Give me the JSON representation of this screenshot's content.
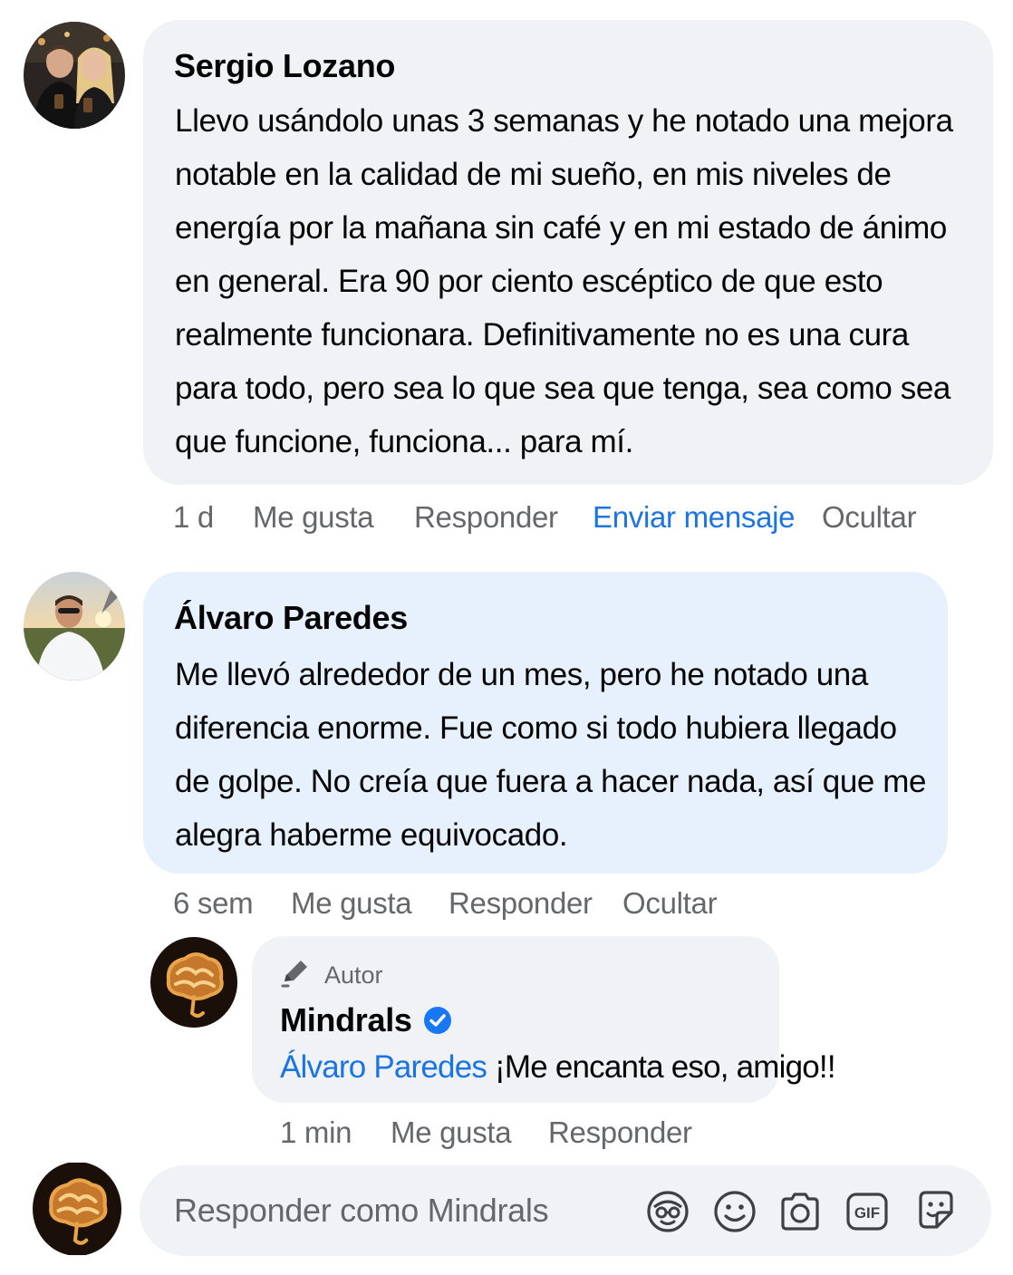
{
  "comments": [
    {
      "author": "Sergio Lozano",
      "text": "Llevo usándolo unas 3 semanas y he notado una mejora notable en la calidad de mi sueño, en mis niveles de energía por la mañana sin café y en mi estado de ánimo en general. Era 90 por ciento escéptico de que esto realmente funcionara. Definitivamente no es una cura para todo, pero sea lo que sea que tenga, sea como sea que funcione, funciona... para mí.",
      "time": "1 d",
      "like": "Me gusta",
      "reply": "Responder",
      "message": "Enviar mensaje",
      "hide": "Ocultar"
    },
    {
      "author": "Álvaro Paredes",
      "text": "Me llevó alrededor de un mes, pero he notado una diferencia enorme. Fue como si todo hubiera llegado de golpe. No creía que fuera a hacer nada, así que me alegra haberme equivocado.",
      "time": "6 sem",
      "like": "Me gusta",
      "reply": "Responder",
      "hide": "Ocultar"
    }
  ],
  "reply": {
    "badge": "Autor",
    "author": "Mindrals",
    "mention": "Álvaro Paredes",
    "text": "¡Me encanta eso, amigo!!",
    "time": "1 min",
    "like": "Me gusta",
    "reply": "Responder"
  },
  "composer": {
    "placeholder": "Responder como Mindrals",
    "tools": [
      "avatar-sticker-icon",
      "emoji-icon",
      "camera-icon",
      "gif-icon",
      "sticker-icon"
    ]
  },
  "colors": {
    "bubble_gray": "#f0f2f5",
    "bubble_highlight": "#e7f1fd",
    "link_blue": "#1b74e4",
    "secondary_text": "#65676b",
    "verified_blue": "#1877f2"
  }
}
